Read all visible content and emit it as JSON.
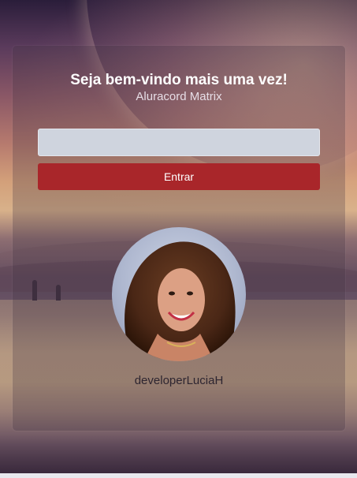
{
  "login": {
    "title": "Seja bem-vindo mais uma vez!",
    "subtitle": "Aluracord Matrix",
    "username_input_value": "",
    "enter_label": "Entrar"
  },
  "profile": {
    "avatar": "avatar-photo",
    "username": "developerLuciaH"
  },
  "colors": {
    "button": "#a9262a",
    "input_bg": "#cfd4de",
    "title_text": "#ffffff"
  }
}
